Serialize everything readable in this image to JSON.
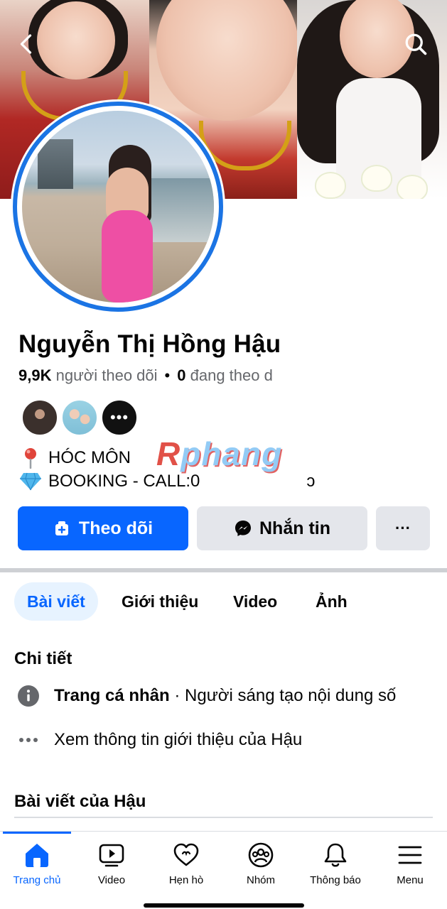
{
  "colors": {
    "accent": "#0866ff",
    "ring": "#1b74e4",
    "secondary_button": "#e4e6eb",
    "muted_text": "#65676b"
  },
  "header": {
    "back_icon": "chevron-left-icon",
    "search_icon": "search-icon"
  },
  "profile": {
    "name": "Nguyễn Thị Hồng Hậu",
    "followers_count": "9,9K",
    "followers_label": "người theo dõi",
    "following_count": "0",
    "following_label": "đang theo d"
  },
  "bio": {
    "location": "HÓC MÔN",
    "booking": "BOOKING - CALL:0"
  },
  "watermark": {
    "r": "R",
    "rest": "phang"
  },
  "actions": {
    "follow_label": "Theo dõi",
    "message_label": "Nhắn tin",
    "more_label": "···"
  },
  "tabs": [
    {
      "label": "Bài viết",
      "active": true
    },
    {
      "label": "Giới thiệu"
    },
    {
      "label": "Video"
    },
    {
      "label": "Ảnh"
    }
  ],
  "details": {
    "title": "Chi tiết",
    "page_type_bold": "Trang cá nhân",
    "page_type_rest": " · Người sáng tạo nội dung số",
    "see_about": "Xem thông tin giới thiệu của Hậu"
  },
  "posts": {
    "title": "Bài viết của Hậu"
  },
  "bottom_nav": [
    {
      "label": "Trang chủ",
      "icon": "home-icon",
      "active": true
    },
    {
      "label": "Video",
      "icon": "video-icon"
    },
    {
      "label": "Hẹn hò",
      "icon": "dating-heart-icon"
    },
    {
      "label": "Nhóm",
      "icon": "groups-icon"
    },
    {
      "label": "Thông báo",
      "icon": "bell-icon"
    },
    {
      "label": "Menu",
      "icon": "menu-icon"
    }
  ]
}
